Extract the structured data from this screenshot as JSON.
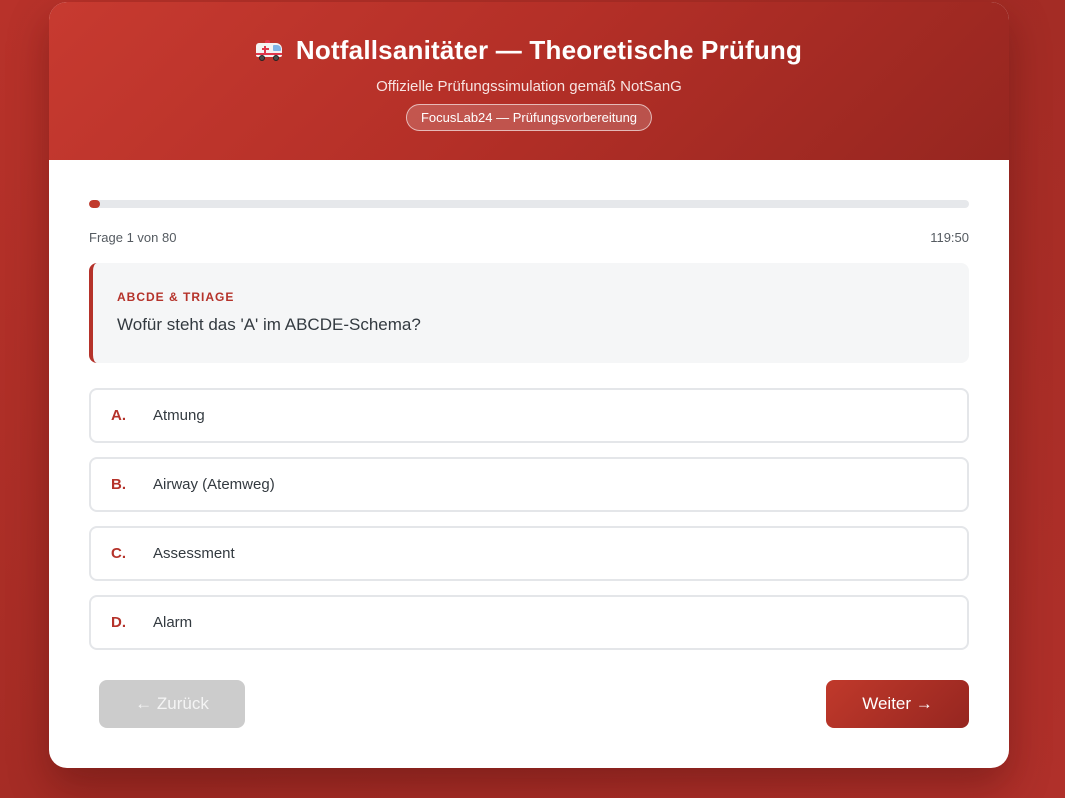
{
  "header": {
    "icon": "ambulance-icon",
    "title": "Notfallsanitäter — Theoretische Prüfung",
    "subtitle": "Offizielle Prüfungssimulation gemäß NotSanG",
    "badge": "FocusLab24 — Prüfungsvorbereitung"
  },
  "progress": {
    "current": 1,
    "total": 80,
    "fraction": 0.0125,
    "label": "Frage 1 von 80",
    "timer": "119:50"
  },
  "question": {
    "category": "ABCDE & TRIAGE",
    "text": "Wofür steht das 'A' im ABCDE-Schema?"
  },
  "answers": [
    {
      "letter": "A.",
      "text": "Atmung"
    },
    {
      "letter": "B.",
      "text": "Airway (Atemweg)"
    },
    {
      "letter": "C.",
      "text": "Assessment"
    },
    {
      "letter": "D.",
      "text": "Alarm"
    }
  ],
  "navigation": {
    "back_label": "← Zurück",
    "back_disabled": true,
    "next_label": "Weiter →"
  },
  "colors": {
    "accent": "#b5322a",
    "background": "#a82d26",
    "disabled": "#cccccc"
  }
}
